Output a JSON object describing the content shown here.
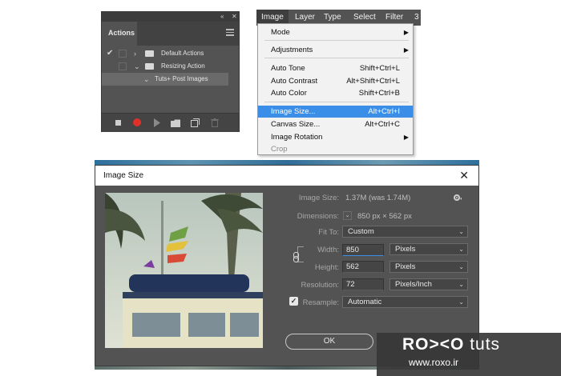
{
  "actions_panel": {
    "collapse_icon": "double-chevron-left",
    "close_icon": "x",
    "tab_label": "Actions",
    "rows": [
      {
        "label": "Default Actions"
      },
      {
        "label": "Resizing Action"
      },
      {
        "label": "Tuts+ Post Images"
      }
    ],
    "bottom_buttons": [
      "stop",
      "record",
      "play",
      "folder",
      "new-action",
      "trash"
    ],
    "record_color": "#e0302a"
  },
  "menubar": {
    "items": [
      "Image",
      "Layer",
      "Type",
      "Select",
      "Filter",
      "3"
    ]
  },
  "image_menu": {
    "items": [
      {
        "label": "Mode",
        "shortcut": "",
        "submenu": true
      },
      {
        "label": "Adjustments",
        "shortcut": "",
        "submenu": true
      },
      {
        "label": "Auto Tone",
        "shortcut": "Shift+Ctrl+L"
      },
      {
        "label": "Auto Contrast",
        "shortcut": "Alt+Shift+Ctrl+L"
      },
      {
        "label": "Auto Color",
        "shortcut": "Shift+Ctrl+B"
      },
      {
        "label": "Image Size...",
        "shortcut": "Alt+Ctrl+I",
        "selected": true
      },
      {
        "label": "Canvas Size...",
        "shortcut": "Alt+Ctrl+C"
      },
      {
        "label": "Image Rotation",
        "shortcut": "",
        "submenu": true
      },
      {
        "label": "Crop",
        "shortcut": "",
        "disabled": true
      }
    ],
    "selection_color": "#3b8ee8"
  },
  "image_size_dialog": {
    "title": "Image Size",
    "image_size_label": "Image Size:",
    "image_size_value": "1.37M (was 1.74M)",
    "dimensions_label": "Dimensions:",
    "dimensions_value": "850 px  ×  562 px",
    "fit_to_label": "Fit To:",
    "fit_to_value": "Custom",
    "width_label": "Width:",
    "width_value": "850",
    "width_unit": "Pixels",
    "height_label": "Height:",
    "height_value": "562",
    "height_unit": "Pixels",
    "resolution_label": "Resolution:",
    "resolution_value": "72",
    "resolution_unit": "Pixels/Inch",
    "resample_label": "Resample:",
    "resample_checked": true,
    "resample_value": "Automatic",
    "ok_label": "OK"
  },
  "watermark": {
    "logo_bold": "RO><O",
    "logo_thin": " tuts",
    "url": "www.roxo.ir"
  }
}
